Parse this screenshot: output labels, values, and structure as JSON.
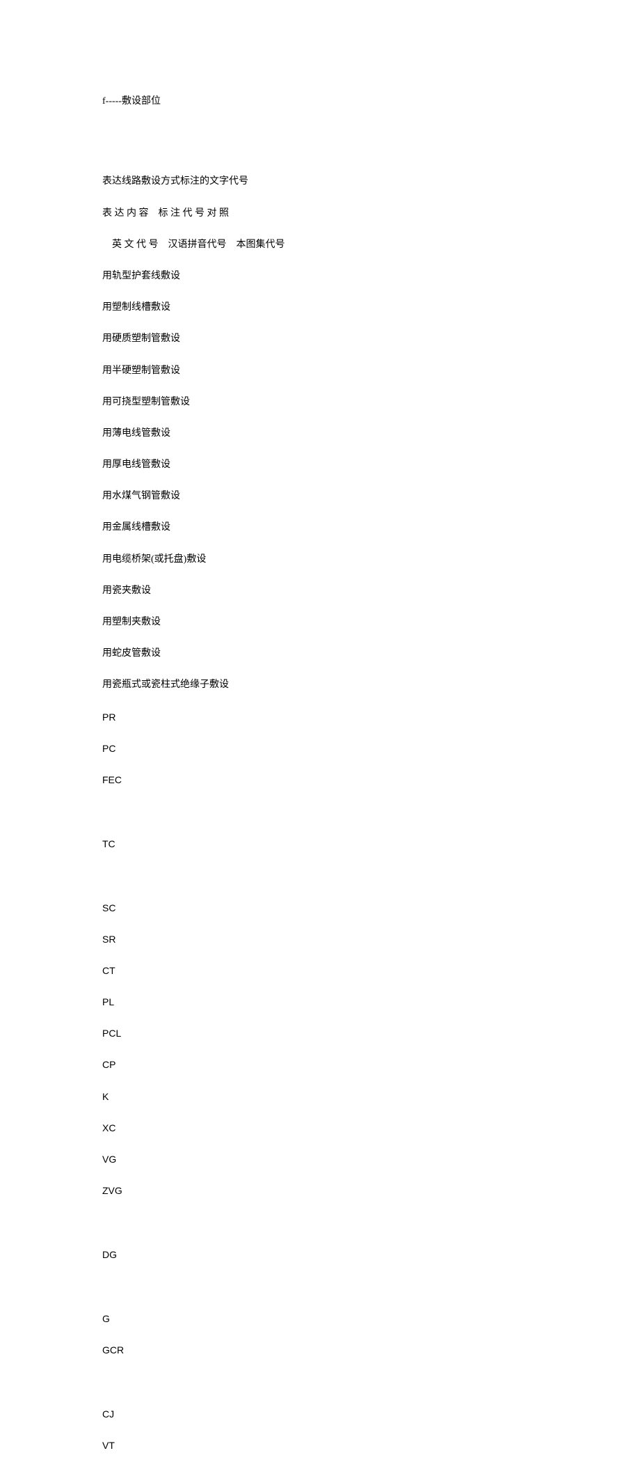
{
  "headerLine": "f-----敷设部位",
  "titleLine": "表达线路敷设方式标注的文字代号",
  "headerRow": "表 达 内 容    标 注 代 号 对 照",
  "subHeaderRow": "英 文 代 号    汉语拼音代号    本图集代号",
  "descriptions": [
    "用轨型护套线敷设",
    "用塑制线槽敷设",
    "用硬质塑制管敷设",
    "用半硬塑制管敷设",
    "用可挠型塑制管敷设",
    "用薄电线管敷设",
    "用厚电线管敷设",
    "用水煤气钢管敷设",
    "用金属线槽敷设",
    "用电缆桥架(或托盘)敷设",
    "用瓷夹敷设",
    "用塑制夹敷设",
    "用蛇皮管敷设",
    "用瓷瓶式或瓷柱式绝缘子敷设"
  ],
  "codes1": [
    "PR",
    "PC",
    "FEC"
  ],
  "codes2": [
    "TC"
  ],
  "codes3": [
    "SC",
    "SR",
    "CT",
    "PL",
    "PCL",
    "CP",
    "K",
    "XC",
    "VG",
    "ZVG"
  ],
  "codes4": [
    "DG"
  ],
  "codes5": [
    "G",
    "GCR"
  ],
  "codes6": [
    "CJ",
    "VT"
  ]
}
